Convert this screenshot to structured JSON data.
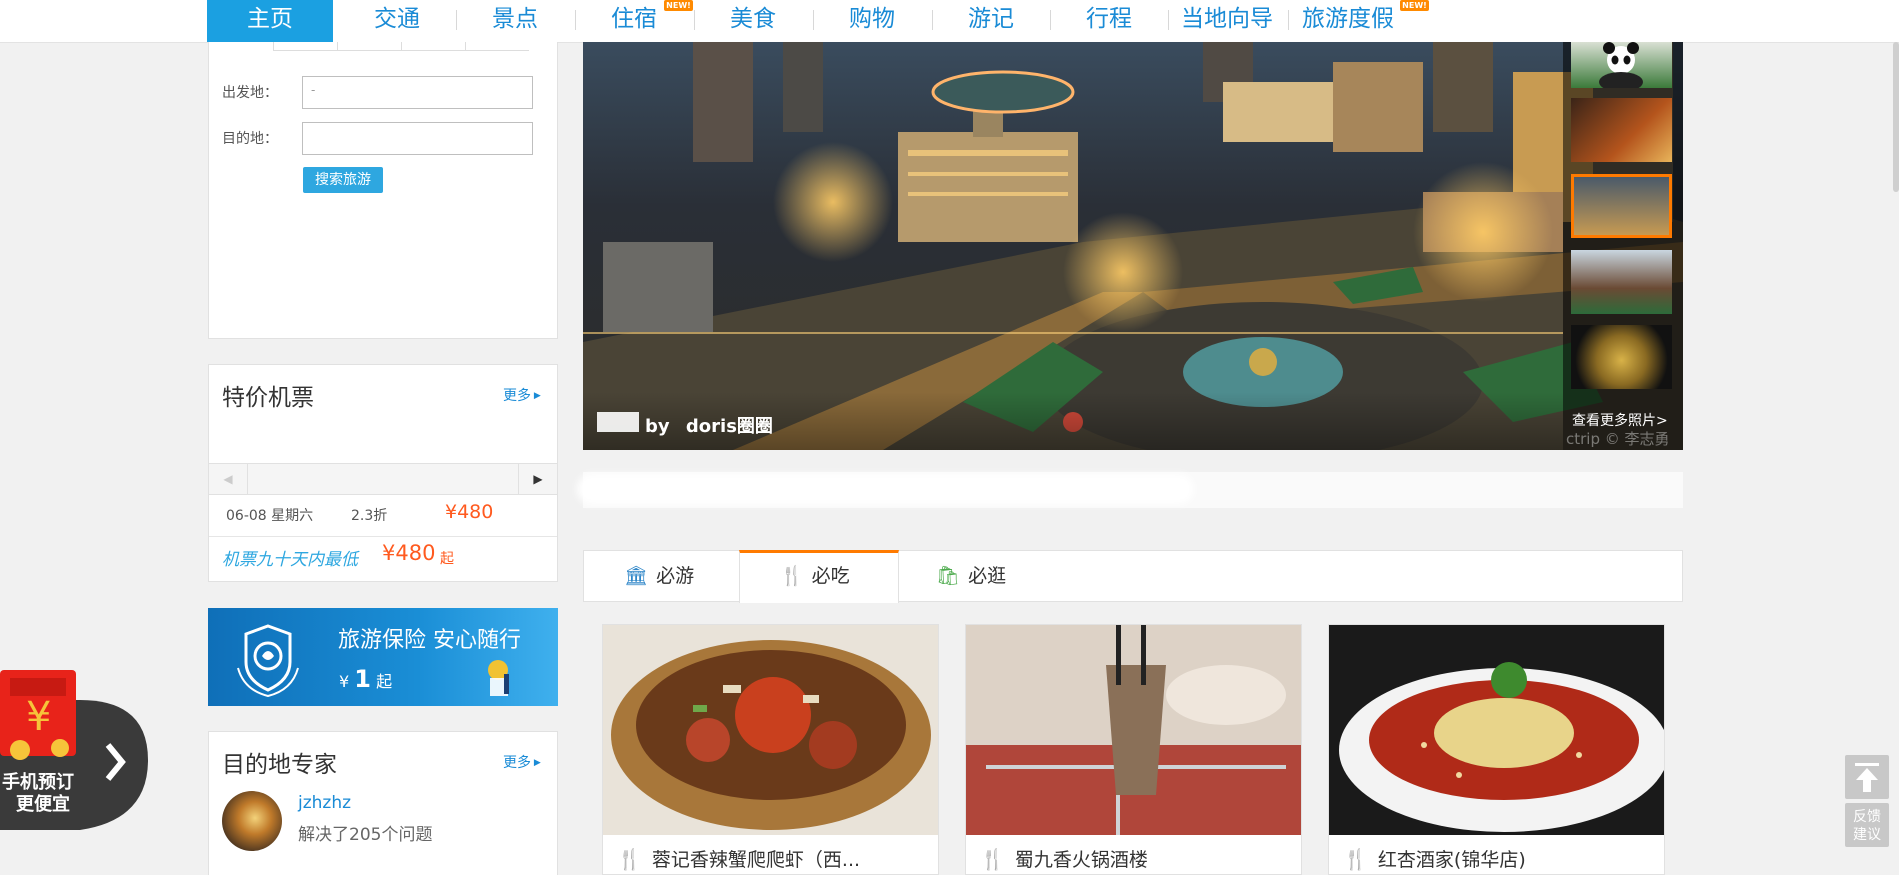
{
  "nav": {
    "items": [
      {
        "label": "主页",
        "active": true,
        "new": false
      },
      {
        "label": "交通",
        "active": false,
        "new": false
      },
      {
        "label": "景点",
        "active": false,
        "new": false
      },
      {
        "label": "住宿",
        "active": false,
        "new": true
      },
      {
        "label": "美食",
        "active": false,
        "new": false
      },
      {
        "label": "购物",
        "active": false,
        "new": false
      },
      {
        "label": "游记",
        "active": false,
        "new": false
      },
      {
        "label": "行程",
        "active": false,
        "new": false
      },
      {
        "label": "当地向导",
        "active": false,
        "new": false
      },
      {
        "label": "旅游度假",
        "active": false,
        "new": true
      }
    ],
    "new_badge": "NEW!"
  },
  "search_panel": {
    "from_label": "出发地：",
    "from_value": "-",
    "to_label": "目的地：",
    "to_value": "",
    "search_button": "搜索旅游"
  },
  "flights": {
    "title": "特价机票",
    "more": "更多",
    "row": {
      "date": "06-08 星期六",
      "discount": "2.3折",
      "price": "¥480"
    },
    "slogan": "机票九十天内最低",
    "slogan_price": "¥480",
    "slogan_suffix": "起"
  },
  "insurance": {
    "title": "旅游保险 安心随行",
    "currency": "¥",
    "price": "1",
    "suffix": "起"
  },
  "experts": {
    "title": "目的地专家",
    "more": "更多",
    "user": "jzhzhz",
    "answered": "解决了205个问题"
  },
  "gallery": {
    "credit_by": "by",
    "credit_author": "doris圈圈",
    "more_photos": "查看更多照片>",
    "watermark": "ctrip © 李志勇"
  },
  "tabs": [
    {
      "label": "必游",
      "icon": "bank-icon",
      "active": false
    },
    {
      "label": "必吃",
      "icon": "fork-knife-icon",
      "active": true
    },
    {
      "label": "必逛",
      "icon": "shopping-bag-icon",
      "active": false
    }
  ],
  "cards": [
    {
      "title": "蓉记香辣蟹爬爬虾（西..."
    },
    {
      "title": "蜀九香火锅酒楼"
    },
    {
      "title": "红杏酒家(锦华店)"
    }
  ],
  "promo": {
    "line1": "手机预订",
    "line2": "更便宜"
  },
  "side_tools": {
    "feedback": "反馈建议"
  },
  "colors": {
    "brand_blue": "#1ba0e1",
    "accent_orange": "#ff7a00",
    "price_red": "#ff5a1f"
  }
}
